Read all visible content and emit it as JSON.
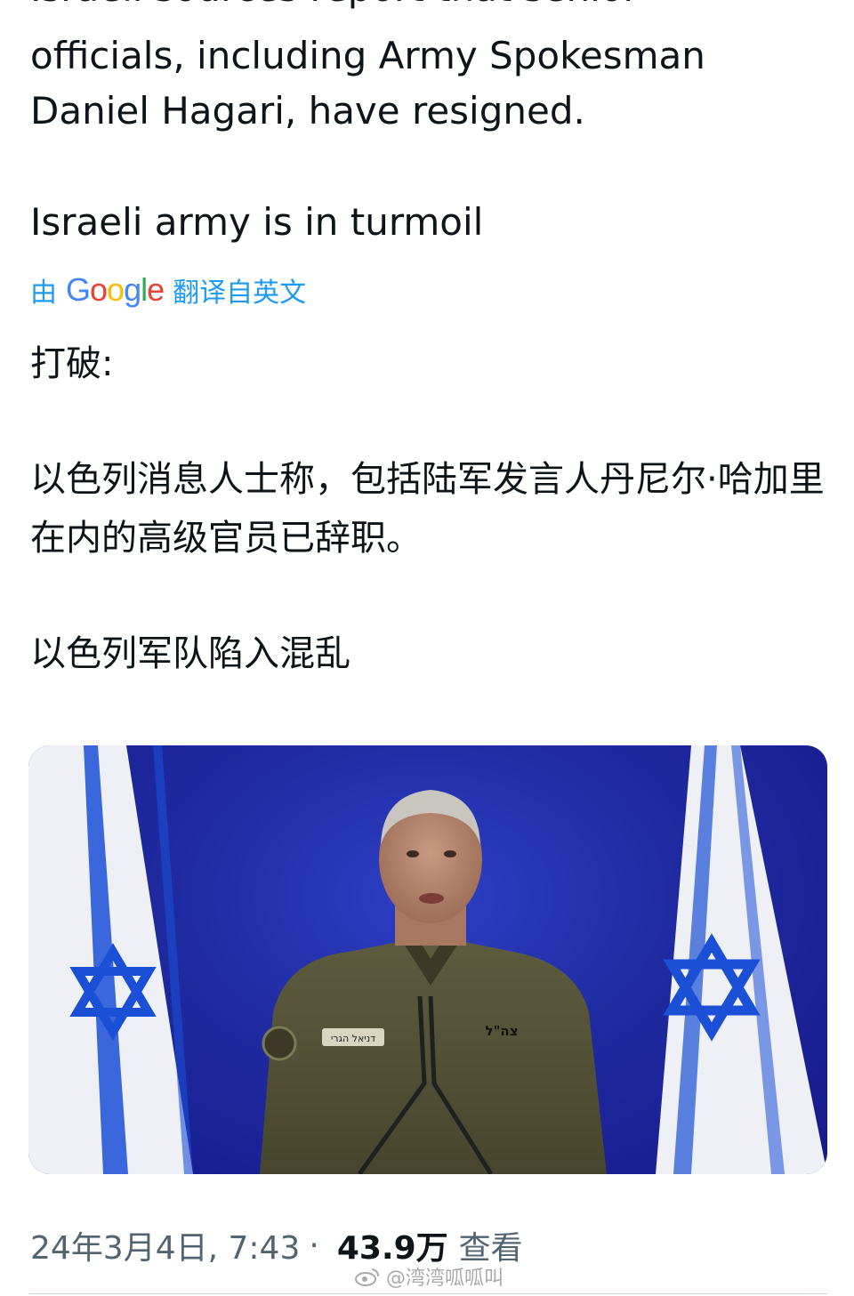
{
  "tweet": {
    "cut_off_line": "Israeli sources report that senior",
    "english_paragraphs": [
      "officials, including Army Spokesman Daniel Hagari, have resigned.",
      "Israeli army is in turmoil"
    ],
    "translation": {
      "prefix": "由",
      "logo_letters": [
        "G",
        "o",
        "o",
        "g",
        "l",
        "e"
      ],
      "suffix": "翻译自英文"
    },
    "chinese_paragraphs": [
      "打破:",
      "以色列消息人士称，包括陆军发言人丹尼尔·哈加里在内的高级官员已辞职。",
      "以色列军队陷入混乱"
    ],
    "photo": {
      "nametag": "דניאל הגרי",
      "unit_tag": "צה\"ל"
    },
    "meta": {
      "timestamp": "24年3月4日, 7:43",
      "separator": "·",
      "views": "43.9万",
      "views_label": "查看"
    }
  },
  "watermark": {
    "text": "@湾湾呱呱叫"
  },
  "colors": {
    "text": "#0f1419",
    "muted": "#536471",
    "link_blue": "#1d9bf0",
    "photo_background": "#1f2aa0",
    "flag_blue": "#1a4fd6"
  }
}
